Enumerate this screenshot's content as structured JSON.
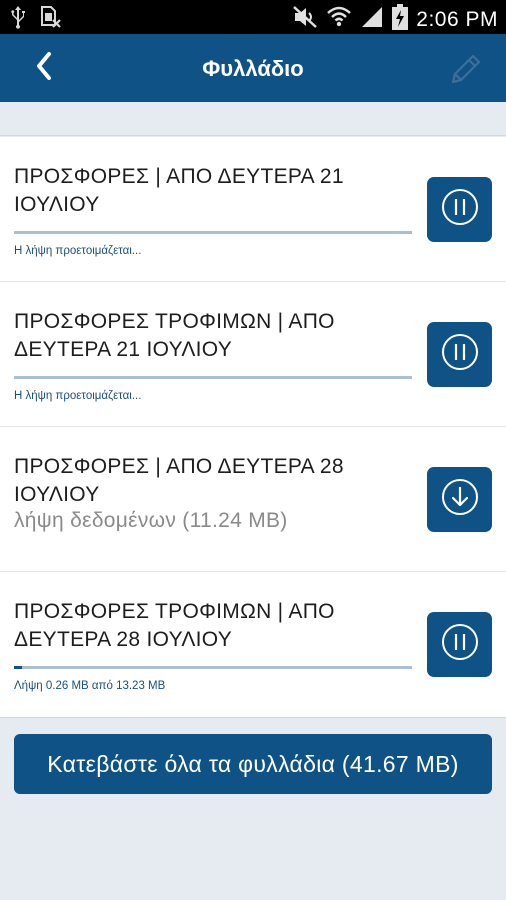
{
  "status_bar": {
    "time": "2:06 PM",
    "icons": [
      "usb-icon",
      "sim-blocked-icon",
      "mute-icon",
      "wifi-icon",
      "signal-icon",
      "battery-charging-icon"
    ]
  },
  "app_bar": {
    "title": "Φυλλάδιο",
    "back_icon": "chevron-left-icon",
    "edit_icon": "pencil-icon"
  },
  "items": [
    {
      "title": "ΠΡΟΣΦΟΡΕΣ | ΑΠΟ ΔΕΥΤΕΡΑ 21 ΙΟΥΛΙΟΥ",
      "status": "Η λήψη προετοιμάζεται...",
      "progress": 0,
      "action": "pause-icon"
    },
    {
      "title": "ΠΡΟΣΦΟΡΕΣ ΤΡΟΦΙΜΩΝ | ΑΠΟ ΔΕΥΤΕΡΑ 21 ΙΟΥΛΙΟΥ",
      "status": "Η λήψη προετοιμάζεται...",
      "progress": 0,
      "action": "pause-icon"
    },
    {
      "title": "ΠΡΟΣΦΟΡΕΣ | ΑΠΟ ΔΕΥΤΕΡΑ 28 ΙΟΥΛΙΟΥ",
      "subtitle": "λήψη δεδομένων (11.24 MB)",
      "action": "download-icon"
    },
    {
      "title": "ΠΡΟΣΦΟΡΕΣ ΤΡΟΦΙΜΩΝ | ΑΠΟ ΔΕΥΤΕΡΑ 28 ΙΟΥΛΙΟΥ",
      "status": "Λήψη 0.26 MB από 13.23 MB",
      "progress": 0.0197,
      "action": "pause-icon"
    }
  ],
  "download_all_label": "Κατεβάστε όλα τα φυλλάδια (41.67 MB)",
  "colors": {
    "primary": "#0f5285",
    "background": "#e6ebf2",
    "progress_track": "#a9bfd2"
  }
}
